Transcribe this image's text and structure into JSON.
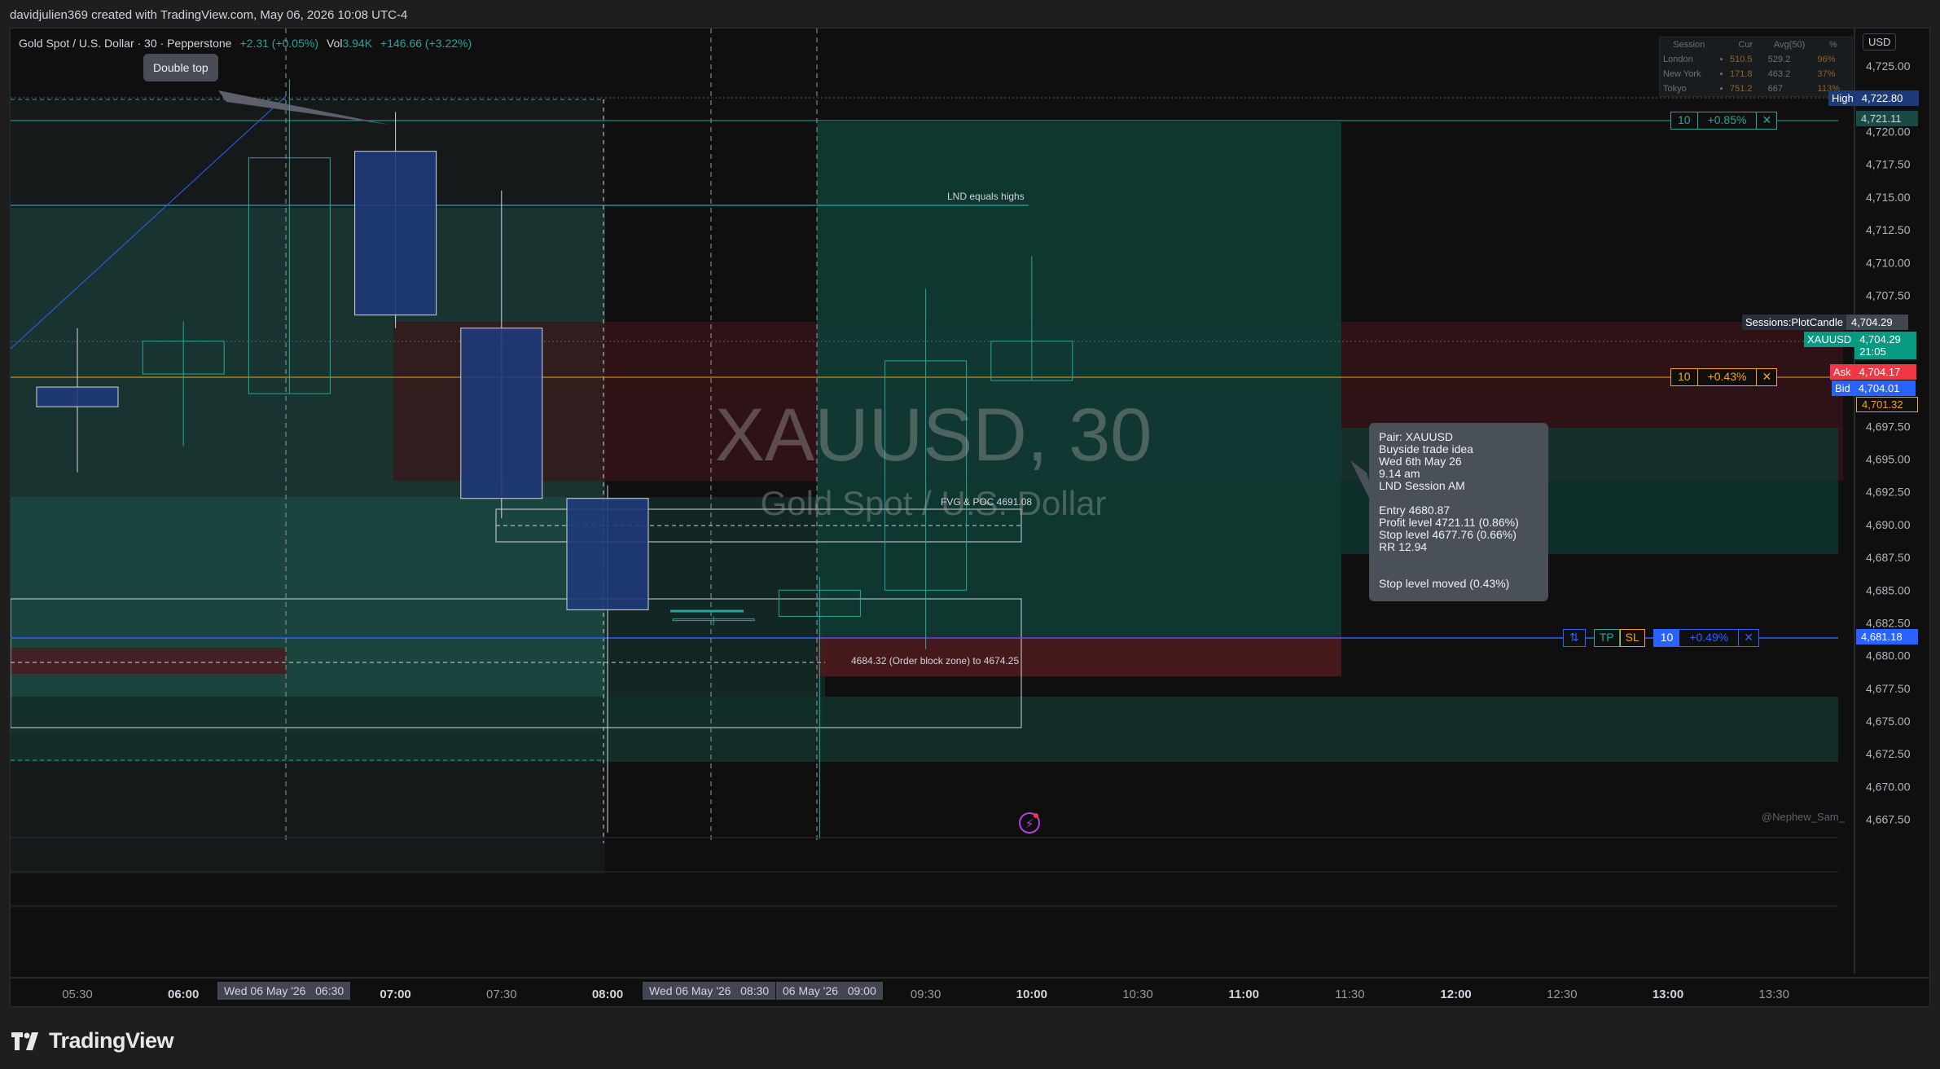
{
  "header": {
    "attribution": "davidjulien369 created with TradingView.com, May 06, 2026 10:08 UTC-4"
  },
  "legend": {
    "symbol_line": "Gold Spot / U.S. Dollar · 30 · Pepperstone",
    "change": "+2.31 (+0.05%)",
    "vol_label": "Vol",
    "vol_value": "3.94K",
    "vol_change": "+146.66 (+3.22%)"
  },
  "watermark": {
    "symbol": "XAUUSD, 30",
    "description": "Gold Spot / U.S. Dollar"
  },
  "currency": "USD",
  "sessions_table": {
    "headers": [
      "Session",
      "Cur",
      "Avg(50)",
      "%"
    ],
    "rows": [
      [
        "London",
        "▪",
        "510.5",
        "529.2",
        "96%"
      ],
      [
        "New York",
        "▪",
        "171.8",
        "463.2",
        "37%"
      ],
      [
        "Tokyo",
        "▪",
        "751.2",
        "667",
        "113%"
      ]
    ]
  },
  "annotations": {
    "double_top": "Double top",
    "lnd_equals_highs": "LND equals highs",
    "fvg_poc": "FVG & POC 4691.08",
    "order_block": "4684.32 (Order block zone) to 4674.25",
    "credit": "@Nephew_Sam_"
  },
  "trade_box": {
    "lines": [
      "Pair: XAUUSD",
      "Buyside trade idea",
      "Wed 6th May 26",
      "9.14 am",
      "LND Session AM",
      "",
      "Entry 4680.87",
      "Profit level 4721.11 (0.86%)",
      "Stop level 4677.76 (0.66%)",
      "RR 12.94",
      "",
      "",
      "Stop level moved (0.43%)"
    ]
  },
  "order_lines": {
    "tp": {
      "qty": "10",
      "pct": "+0.85%",
      "close": "✕"
    },
    "sl": {
      "qty": "10",
      "pct": "+0.43%",
      "close": "✕"
    },
    "entry": {
      "ratio": "⇅",
      "tp": "TP",
      "sl": "SL",
      "qty": "10",
      "pct": "+0.49%",
      "close": "✕"
    }
  },
  "price_axis": {
    "ticks": [
      "4,725.00",
      "4,720.00",
      "4,717.50",
      "4,715.00",
      "4,712.50",
      "4,710.00",
      "4,707.50",
      "4,697.50",
      "4,695.00",
      "4,692.50",
      "4,690.00",
      "4,687.50",
      "4,685.00",
      "4,682.50",
      "4,680.00",
      "4,677.50",
      "4,675.00",
      "4,672.50",
      "4,670.00",
      "4,667.50"
    ],
    "labels": {
      "high_tag": "High",
      "high_value": "4,722.80",
      "tp_value": "4,721.11",
      "sessions_tag": "Sessions:PlotCandle",
      "sessions_value": "4,704.29",
      "symbol_tag": "XAUUSD",
      "last_value": "4,704.29",
      "countdown": "21:05",
      "ask_tag": "Ask",
      "ask_value": "4,704.17",
      "bid_tag": "Bid",
      "bid_value": "4,704.01",
      "sl_value": "4,701.32",
      "entry_value": "4,681.18"
    }
  },
  "time_axis": {
    "ticks": [
      "05:30",
      "06:00",
      "07:00",
      "07:30",
      "08:00",
      "09:30",
      "10:00",
      "10:30",
      "11:00",
      "11:30",
      "12:00",
      "12:30",
      "13:00",
      "13:30"
    ],
    "highlights": [
      "Wed 06 May '26   06:30",
      "Wed 06 May '26   08:30",
      "06 May '26   09:00"
    ]
  },
  "footer": {
    "brand": "TradingView"
  },
  "colors": {
    "bull": "#26a69a",
    "bear_fill": "#1f3a7a",
    "sl_orange": "#f7a21b",
    "entry_blue": "#2962ff",
    "ask_red": "#f23645"
  },
  "chart_data": {
    "type": "candlestick",
    "symbol": "XAUUSD",
    "interval": "30",
    "x": [
      "05:30",
      "06:00",
      "06:30",
      "07:00",
      "07:30",
      "08:00",
      "08:30",
      "09:00",
      "09:30",
      "10:00"
    ],
    "series": [
      {
        "open": [
          4700.5,
          4701.5,
          4700.0,
          4718.5,
          4705.0,
          4692.0,
          4682.8,
          4683.0,
          4685.0,
          4701.0
        ],
        "high": [
          4705.0,
          4705.5,
          4724.0,
          4721.5,
          4715.5,
          4693.0,
          4683.0,
          4686.0,
          4708.0,
          4710.5
        ],
        "low": [
          4694.0,
          4696.0,
          4700.0,
          4705.0,
          4690.5,
          4666.5,
          4682.3,
          4666.0,
          4680.5,
          4701.0
        ],
        "close": [
          4699.0,
          4704.0,
          4718.0,
          4706.0,
          4692.0,
          4683.5,
          4682.8,
          4685.0,
          4702.5,
          4704.0
        ]
      }
    ],
    "ylim": [
      4665.0,
      4727.0
    ]
  }
}
